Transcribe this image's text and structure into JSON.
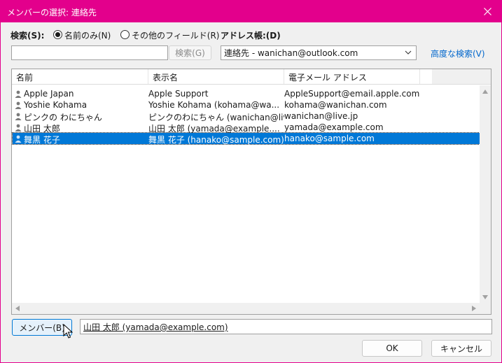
{
  "window": {
    "title": "メンバーの選択: 連絡先",
    "accent_color": "#e3008c",
    "close_icon": "close-icon"
  },
  "search": {
    "label": "検索(S):",
    "radio_name_only": "名前のみ(N)",
    "radio_other_fields": "その他のフィールド(R)",
    "selected_mode": "name_only",
    "input_value": "",
    "search_button": "検索(G)"
  },
  "address_book": {
    "label": "アドレス帳:(D)",
    "selected": "連絡先 - wanichan@outlook.com",
    "advanced_search": "高度な検索(V)"
  },
  "table": {
    "columns": [
      "名前",
      "表示名",
      "電子メール アドレス"
    ],
    "rows": [
      {
        "name": "Apple Japan",
        "display": "Apple Support",
        "email": "AppleSupport@email.apple.com",
        "selected": false
      },
      {
        "name": "Yoshie Kohama",
        "display": "Yoshie Kohama (kohama@wa...",
        "email": "kohama@wanichan.com",
        "selected": false
      },
      {
        "name": "ピンクの わにちゃん",
        "display": "ピンクのわにちゃん (wanichan@live...",
        "email": "wanichan@live.jp",
        "selected": false
      },
      {
        "name": "山田 太郎",
        "display": "山田 太郎 (yamada@example....",
        "email": "yamada@example.com",
        "selected": false
      },
      {
        "name": "舞黒 花子",
        "display": "舞黒 花子 (hanako@sample.com)",
        "email": "hanako@sample.com",
        "selected": true
      }
    ],
    "selection_color": "#0078d7"
  },
  "members": {
    "button": "メンバー(B)",
    "value": "山田 太郎 (yamada@example.com)"
  },
  "footer": {
    "ok": "OK",
    "cancel": "キャンセル"
  }
}
